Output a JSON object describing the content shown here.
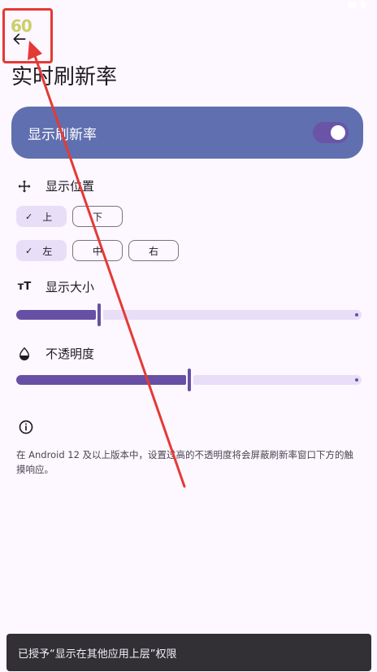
{
  "fps_overlay": "60",
  "title": "实时刷新率",
  "main_toggle": {
    "label": "显示刷新率",
    "on": true
  },
  "position": {
    "label": "显示位置",
    "vertical": [
      {
        "label": "上",
        "selected": true
      },
      {
        "label": "下",
        "selected": false
      }
    ],
    "horizontal": [
      {
        "label": "左",
        "selected": true
      },
      {
        "label": "中",
        "selected": false
      },
      {
        "label": "右",
        "selected": false
      }
    ],
    "check": "✓"
  },
  "size": {
    "label": "显示大小",
    "value": 0.24
  },
  "opacity": {
    "label": "不透明度",
    "value": 0.5
  },
  "info": {
    "text": "在 Android 12 及以上版本中，设置过高的不透明度将会屏蔽刷新率窗口下方的触摸响应。"
  },
  "snackbar": {
    "text": "已授予“显示在其他应用上层”权限"
  },
  "colors": {
    "background": "#fdf7ff",
    "card": "#5f6fb0",
    "accent": "#6750a4",
    "track": "#e8def8",
    "annotation": "#e53935"
  }
}
